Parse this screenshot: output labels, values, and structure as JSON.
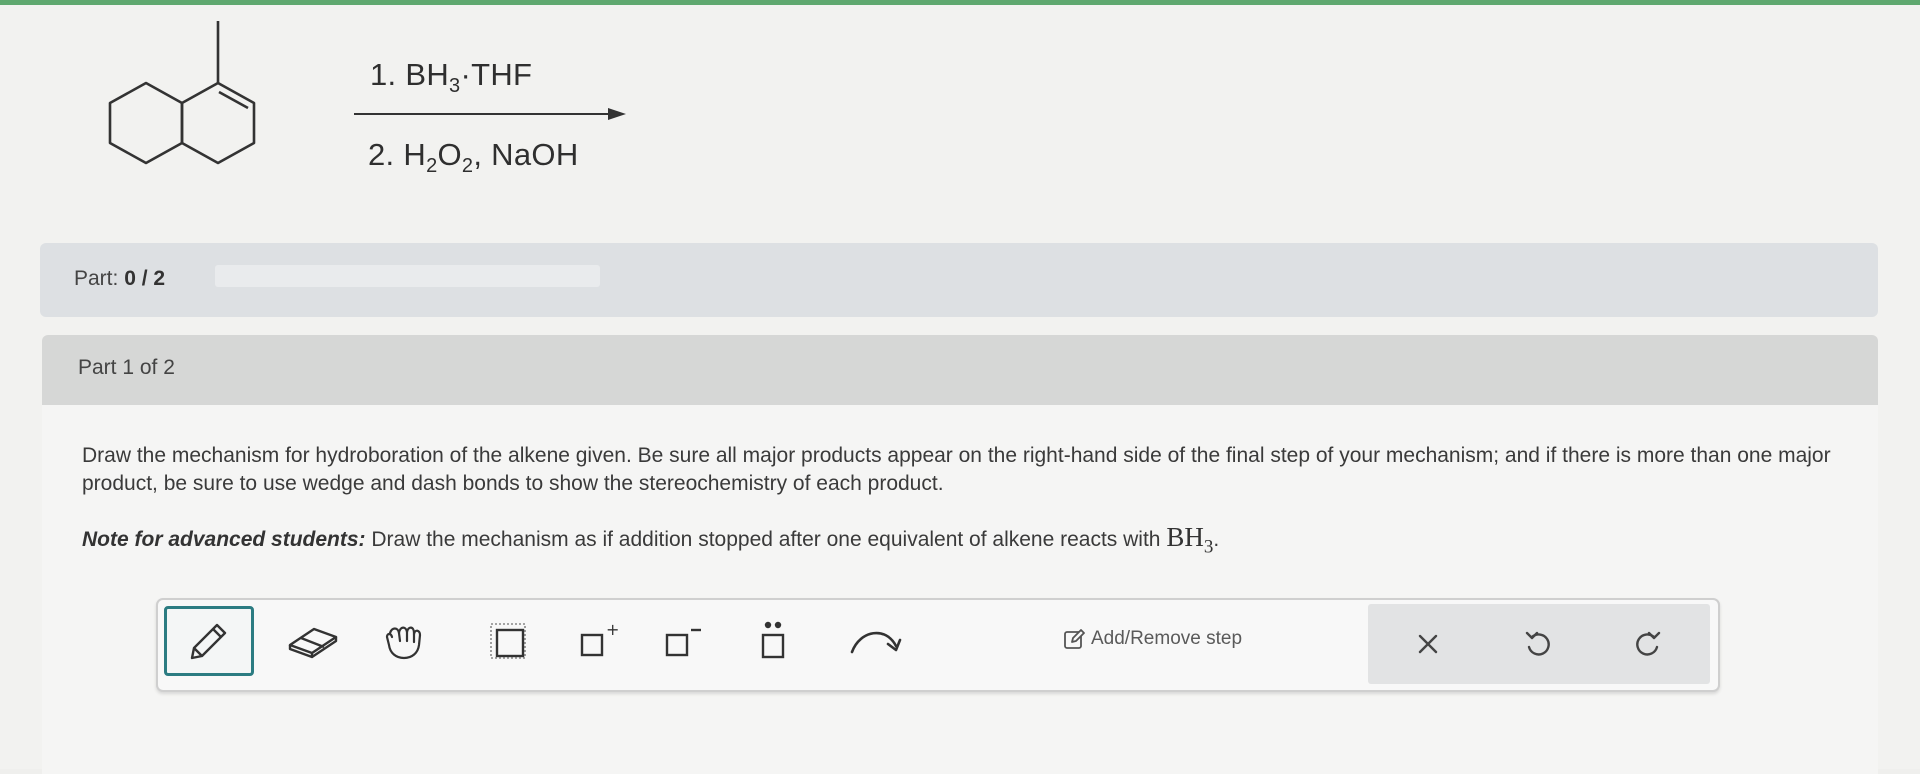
{
  "reaction": {
    "reagent1": "1. BH",
    "reagent1_sub": "3",
    "reagent1_rest": "·THF",
    "reagent2": "2. H",
    "reagent2_sub1": "2",
    "reagent2_mid": "O",
    "reagent2_sub2": "2",
    "reagent2_rest": ", NaOH"
  },
  "part_bar": {
    "label_prefix": "Part: ",
    "label_value": "0 / 2",
    "progress": 0
  },
  "part1": {
    "title": "Part 1 of 2",
    "question": "Draw the mechanism for hydroboration of the alkene given. Be sure all major products appear on the right-hand side of the final step of your mechanism; and if there is more than one major product, be sure to use wedge and dash bonds to show the stereochemistry of each product.",
    "note_label": "Note for advanced students:",
    "note_text": " Draw the mechanism as if addition stopped after one equivalent of alkene reacts with ",
    "note_formula": "BH",
    "note_formula_sub": "3",
    "note_end": "."
  },
  "toolbar": {
    "tools": [
      {
        "name": "pencil-icon",
        "selected": true
      },
      {
        "name": "eraser-icon"
      },
      {
        "name": "hand-icon"
      },
      {
        "name": "selection-box-icon"
      },
      {
        "name": "positive-charge-icon",
        "symbol": "+"
      },
      {
        "name": "negative-charge-icon",
        "symbol": "−"
      },
      {
        "name": "lone-pair-icon"
      },
      {
        "name": "curved-arrow-icon"
      }
    ],
    "add_remove_label": "Add/Remove step",
    "right_actions": [
      "close-icon",
      "undo-icon",
      "redo-icon"
    ]
  },
  "colors": {
    "accent_teal": "#2c7c82",
    "top_green": "#5fa86f"
  }
}
